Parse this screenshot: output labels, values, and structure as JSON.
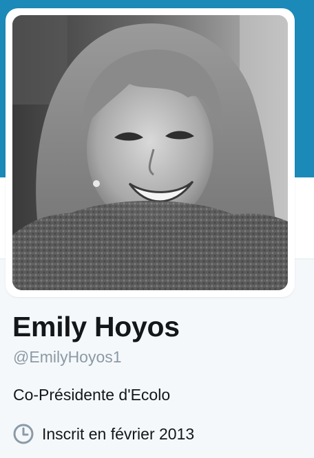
{
  "profile": {
    "name": "Emily Hoyos",
    "handle": "@EmilyHoyos1",
    "bio": "Co-Présidente d'Ecolo",
    "joined": "Inscrit en février 2013",
    "joined_icon": "clock-icon",
    "avatar_description": "profile-photo"
  },
  "colors": {
    "banner": "#1b8ab8",
    "background": "#f5f8fa",
    "name": "#14171a",
    "handle": "#8b9aa6",
    "icon": "#8b9aa6"
  }
}
